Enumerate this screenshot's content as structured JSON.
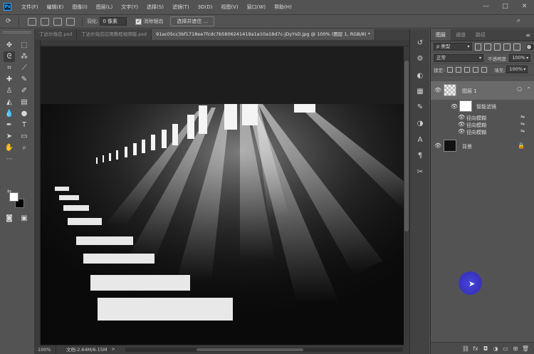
{
  "app": {
    "logo": "Ps"
  },
  "menu": [
    "文件(F)",
    "编辑(E)",
    "图像(I)",
    "图层(L)",
    "文字(Y)",
    "选择(S)",
    "滤镜(T)",
    "3D(D)",
    "视图(V)",
    "窗口(W)",
    "帮助(H)"
  ],
  "window_controls": [
    "—",
    "□",
    "✕"
  ],
  "options": {
    "feather_label": "羽化:",
    "feather_value": "0 像素",
    "antialias_label": "消除锯齿",
    "antialias_checked": true,
    "select_mask_button": "选择并遮住 ..."
  },
  "tabs": [
    {
      "label": "丁达尔效应.psd",
      "active": false
    },
    {
      "label": "丁达尔效应应用教程视频版.psd",
      "active": false
    },
    {
      "label": "91ac05cc3bf1718ee7fcdc7b5806241419a1a10a18d7c-jDyYsD.jpg @ 100% (图层 1, RGB/8) *",
      "active": true
    }
  ],
  "status": {
    "zoom": "100%",
    "doc": "文档:2.64M/6.15M",
    "arrow": ">"
  },
  "panel": {
    "tabs": [
      {
        "label": "图层",
        "active": true
      },
      {
        "label": "通道",
        "active": false
      },
      {
        "label": "路径",
        "active": false
      }
    ],
    "filter_kind": "ρ 类型",
    "blend_mode": "正常",
    "opacity_label": "不透明度:",
    "opacity_value": "100%",
    "lock_label": "锁定:",
    "fill_label": "填充:",
    "fill_value": "100%"
  },
  "layers": [
    {
      "name": "图层 1",
      "type": "smart-object",
      "selected": true
    },
    {
      "name": "智能滤镜",
      "type": "smart-filters"
    },
    {
      "name": "径向模糊",
      "type": "filter"
    },
    {
      "name": "径向模糊",
      "type": "filter"
    },
    {
      "name": "径向模糊",
      "type": "filter"
    },
    {
      "name": "背景",
      "type": "background",
      "locked": true
    }
  ],
  "colors": {
    "ui_bg": "#535353",
    "panel_dark": "#424242",
    "canvas_bg": "#282828",
    "selected_layer": "#6a6a6a",
    "cursor_highlight": "#3934c0"
  },
  "icons": [
    "move-icon",
    "marquee-icon",
    "lasso-icon",
    "crop-icon",
    "eyedropper-icon",
    "healing-icon",
    "brush-icon",
    "stamp-icon",
    "history-brush-icon",
    "eraser-icon",
    "gradient-icon",
    "blur-icon",
    "dodge-icon",
    "pen-icon",
    "type-icon",
    "path-select-icon",
    "shape-icon",
    "hand-icon",
    "zoom-icon",
    "quickmask-icon",
    "screenmode-icon"
  ]
}
